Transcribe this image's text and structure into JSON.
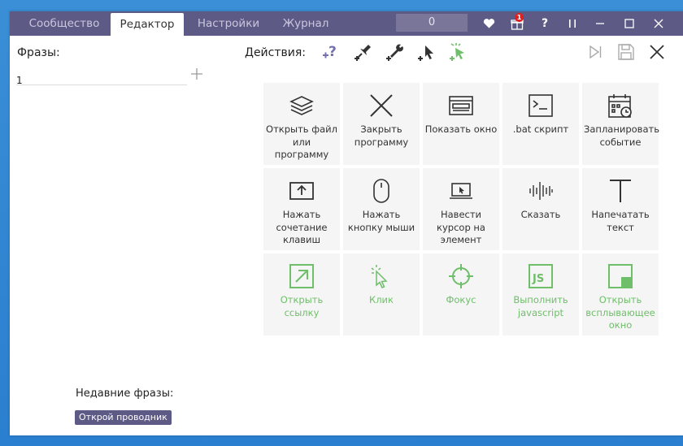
{
  "tabs": [
    "Сообщество",
    "Редактор",
    "Настройки",
    "Журнал"
  ],
  "counter": "0",
  "notification_count": "1",
  "phrases_label": "Фразы:",
  "phrase_value": "1",
  "actions_label": "Действия:",
  "tiles": [
    "Открыть файл или программу",
    "Закрыть программу",
    "Показать окно",
    ".bat скрипт",
    "Запланировать событие",
    "Нажать сочетание клавиш",
    "Нажать кнопку мыши",
    "Навести курсор на элемент",
    "Сказать",
    "Напечатать текст",
    "Открыть ссылку",
    "Клик",
    "Фокус",
    "Выполнить javascript",
    "Открыть всплывающее окно"
  ],
  "recent_label": "Недавние фразы:",
  "recent_items": [
    "Открой проводник"
  ],
  "colors": {
    "titlebar": "#5e5a86",
    "accent_green": "#6fbf6a",
    "tile_bg": "#f5f5f5"
  }
}
